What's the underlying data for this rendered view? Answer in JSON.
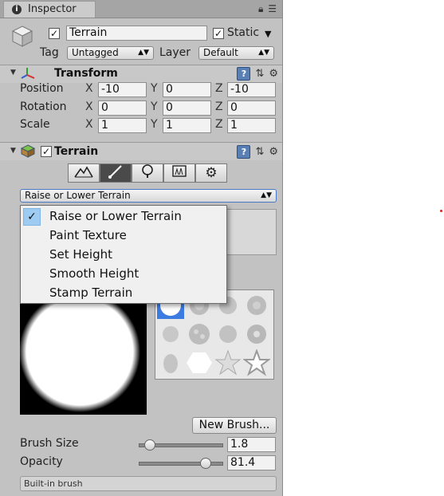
{
  "window": {
    "tab_title": "Inspector",
    "tab_icon": "info-icon"
  },
  "gameobject": {
    "active": true,
    "name": "Terrain",
    "static_label": "Static",
    "static_checked": true,
    "tag_label": "Tag",
    "tag_value": "Untagged",
    "layer_label": "Layer",
    "layer_value": "Default"
  },
  "transform": {
    "title": "Transform",
    "rows": [
      {
        "label": "Position",
        "x": "-10",
        "y": "0",
        "z": "-10"
      },
      {
        "label": "Rotation",
        "x": "0",
        "y": "0",
        "z": "0"
      },
      {
        "label": "Scale",
        "x": "1",
        "y": "1",
        "z": "1"
      }
    ],
    "axis_x": "X",
    "axis_y": "Y",
    "axis_z": "Z"
  },
  "terrain": {
    "title": "Terrain",
    "enabled": true,
    "tools": [
      {
        "name": "raise-terrain-tool",
        "icon": "mountain-icon",
        "selected": false
      },
      {
        "name": "paint-tool",
        "icon": "brush-icon",
        "selected": true
      },
      {
        "name": "tree-tool",
        "icon": "tree-icon",
        "selected": false
      },
      {
        "name": "detail-tool",
        "icon": "grass-icon",
        "selected": false
      },
      {
        "name": "settings-tool",
        "icon": "gear-icon",
        "selected": false
      }
    ],
    "mode_selected": "Raise or Lower Terrain",
    "mode_options": [
      "Raise or Lower Terrain",
      "Paint Texture",
      "Set Height",
      "Smooth Height",
      "Stamp Terrain"
    ],
    "new_brush_label": "New Brush...",
    "brush_size_label": "Brush Size",
    "brush_size_value": "1.8",
    "brush_size_fraction": 0.08,
    "opacity_label": "Opacity",
    "opacity_value": "81.4",
    "opacity_fraction": 0.81,
    "builtin_label": "Built-in brush"
  },
  "colors": {
    "panel_bg": "#c2c2c2",
    "selection_blue": "#9ecbf2",
    "selected_brush": "#3c7be0",
    "red_dot": "#e02020"
  }
}
